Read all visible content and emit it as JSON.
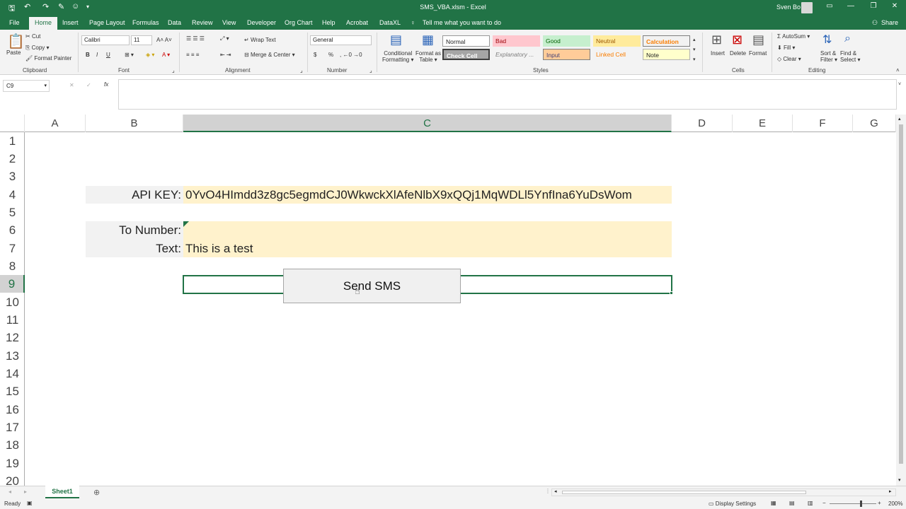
{
  "window": {
    "title": "SMS_VBA.xlsm - Excel",
    "user": "Sven Bo"
  },
  "tabs": [
    "File",
    "Home",
    "Insert",
    "Page Layout",
    "Formulas",
    "Data",
    "Review",
    "View",
    "Developer",
    "Org Chart",
    "Help",
    "Acrobat",
    "DataXL"
  ],
  "tell_me": "Tell me what you want to do",
  "share": "Share",
  "ribbon": {
    "clipboard": {
      "label": "Clipboard",
      "paste": "Paste",
      "cut": "Cut",
      "copy": "Copy",
      "format_painter": "Format Painter"
    },
    "font": {
      "label": "Font",
      "name": "Calibri",
      "size": "11",
      "bold": "B",
      "italic": "I",
      "underline": "U"
    },
    "alignment": {
      "label": "Alignment",
      "wrap": "Wrap Text",
      "merge": "Merge & Center"
    },
    "number": {
      "label": "Number",
      "format": "General",
      "currency": "$",
      "percent": "%"
    },
    "styles": {
      "label": "Styles",
      "conditional": "Conditional",
      "conditional2": "Formatting",
      "format_as_table": "Format as",
      "format_as_table2": "Table",
      "normal": "Normal",
      "bad": "Bad",
      "good": "Good",
      "neutral": "Neutral",
      "calculation": "Calculation",
      "check_cell": "Check Cell",
      "explanatory": "Explanatory ...",
      "input": "Input",
      "linked_cell": "Linked Cell",
      "note": "Note"
    },
    "cells": {
      "label": "Cells",
      "insert": "Insert",
      "delete": "Delete",
      "format": "Format"
    },
    "editing": {
      "label": "Editing",
      "autosum": "AutoSum",
      "fill": "Fill",
      "clear": "Clear",
      "sort": "Sort &",
      "sort2": "Filter",
      "find": "Find &",
      "find2": "Select"
    }
  },
  "formula_bar": {
    "name_box": "C9",
    "fx": "fx",
    "formula": ""
  },
  "columns": [
    "A",
    "B",
    "C",
    "D",
    "E",
    "F",
    "G"
  ],
  "rows": [
    "1",
    "2",
    "3",
    "4",
    "5",
    "6",
    "7",
    "8",
    "9",
    "10",
    "11",
    "12",
    "13",
    "14",
    "15",
    "16",
    "17",
    "18",
    "19",
    "20"
  ],
  "cells": {
    "b4": "API KEY:",
    "c4": "0YvO4HImdd3z8gc5egmdCJ0WkwckXlAfeNlbX9xQQj1MqWDLl5YnfIna6YuDsWom",
    "b6": "To Number:",
    "b7": "Text:",
    "c7": "This is a test"
  },
  "button": {
    "label": "Send SMS"
  },
  "sheets": [
    "Sheet1"
  ],
  "status": {
    "ready": "Ready",
    "display_settings": "Display Settings",
    "zoom": "200%"
  }
}
